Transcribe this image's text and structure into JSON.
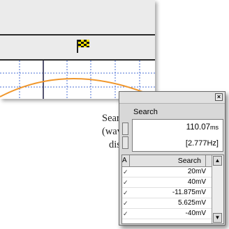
{
  "caption": {
    "line1": "Search marker",
    "line2": "(waveform",
    "line3": "display screen)"
  },
  "waveform": {
    "marker_icon": "checkered-flag-icon",
    "grid_color": "#4a6fd4",
    "curve_color": "#f0962a"
  },
  "search_window": {
    "close_label": "×",
    "title": "Search",
    "time_value": "110.07",
    "time_unit": "ms",
    "freq_value": "[2.777Hz]",
    "table": {
      "col_a": "A",
      "col_search": "Search",
      "rows": [
        {
          "check": "✓",
          "value": "20mV"
        },
        {
          "check": "✓",
          "value": "40mV"
        },
        {
          "check": "✓",
          "value": "-11.875mV"
        },
        {
          "check": "✓",
          "value": "5.625mV"
        },
        {
          "check": "✓",
          "value": "-40mV"
        }
      ]
    },
    "scroll_up": "▲",
    "scroll_down": "▼"
  }
}
